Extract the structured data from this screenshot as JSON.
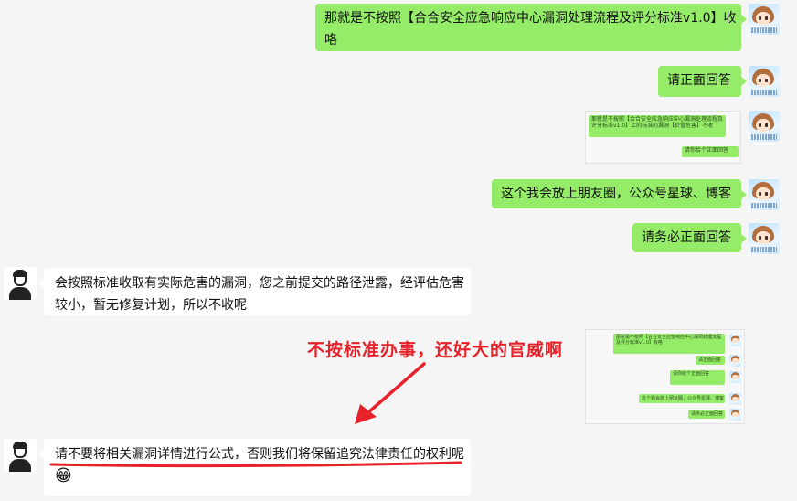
{
  "outgoing": [
    {
      "text": "那就是不按照【合合安全应急响应中心漏洞处理流程及评分标准v1.0】收",
      "text2": "咯"
    },
    {
      "text": "请正面回答"
    },
    {
      "text": "这个我会放上朋友圈，公众号星球、博客"
    },
    {
      "text": "请务必正面回答"
    }
  ],
  "screenshot_small": {
    "line1": "那就是不按照【合合安全应急响应中心漏洞处理流程及",
    "line2": "评分标准v1.0】上的标准的漏洞【价值危害】不收",
    "reply": "请你给个正面回答"
  },
  "screenshot_mini": {
    "line1": "那就是不按照【合合安全应急响应中心漏洞处理流程",
    "line2": "及评分标准v1.0】收咯",
    "reply1": "请正面回答",
    "reply2": "请你给个正面回答",
    "reply3": "这个我会放上朋友圈，公众号星球、博客",
    "reply4": "请务必正面回答"
  },
  "incoming": [
    {
      "line1": "会按照标准收取有实际危害的漏洞，您之前提交的路径泄露，经评估危害",
      "line2": "较小，暂无修复计划，所以不收呢"
    },
    {
      "line1": "请不要将相关漏洞详情进行公式，否则我们将保留追究法律责任的权利呢",
      "emoji": "😁"
    }
  ],
  "annotation": {
    "text": "不按标准办事，还好大的官威啊",
    "color": "#e8222a"
  },
  "colors": {
    "outgoing_bubble": "#95ec69",
    "incoming_bubble": "#ffffff",
    "background": "#f5f5f5",
    "annotation_red": "#e8222a"
  }
}
